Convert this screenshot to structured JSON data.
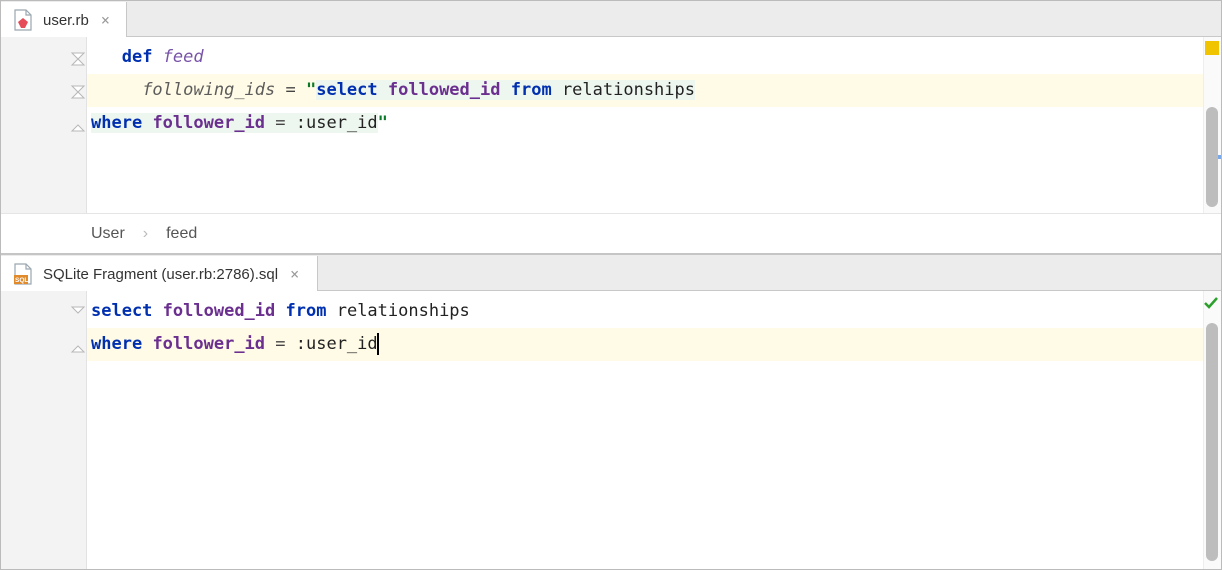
{
  "topTab": {
    "filename": "user.rb"
  },
  "rubyCode": {
    "line1": {
      "def": "def",
      "name": "feed"
    },
    "line2": {
      "var": "following_ids",
      "eq": " = ",
      "q": "\"",
      "select": "select",
      "col": "followed_id",
      "from": "from",
      "rel": "relationships"
    },
    "line3": {
      "where": "where",
      "col": "follower_id",
      "eq2": " = ",
      "param": ":user_id",
      "q2": "\""
    }
  },
  "breadcrumb": {
    "class": "User",
    "method": "feed"
  },
  "bottomTab": {
    "filename": "SQLite Fragment (user.rb:2786).sql"
  },
  "sqlCode": {
    "line1": {
      "select": "select",
      "col": "followed_id",
      "from": "from",
      "rel": "relationships"
    },
    "line2": {
      "where": "where",
      "col": "follower_id",
      "eq": " = ",
      "param": ":user_id"
    }
  }
}
